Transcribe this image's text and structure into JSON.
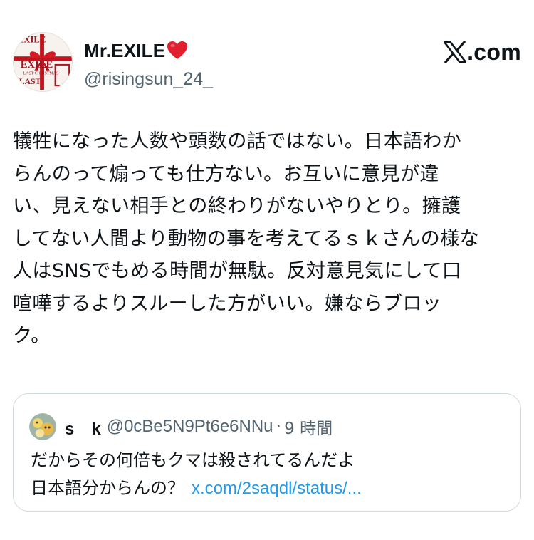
{
  "author": {
    "display_name": "Mr.EXILE",
    "name_emoji_icon": "red-heart-icon",
    "handle": "@risingsun_24_",
    "avatar_text": [
      "EXILE",
      "EXILE",
      "LAST CHRISTMAS",
      "LAST"
    ]
  },
  "brand": {
    "logo_icon": "x-logo-icon",
    "domain": ".com"
  },
  "tweet": {
    "lines": [
      "犠牲になった人数や頭数の話ではない。日本語わか",
      "らんのって煽っても仕方ない。お互いに意見が違",
      "い、見えない相手との終わりがないやりとり。擁護",
      "してない人間より動物の事を考えてるｓｋさんの様な",
      "人はSNSでもめる時間が無駄。反対意見気にして口",
      "喧嘩するよりスルーした方がいい。嫌ならブロッ",
      "ク。"
    ]
  },
  "quoted_tweet": {
    "display_name": "s　k",
    "handle": "@0cBe5N9Pt6e6NNu",
    "separator": "·",
    "time": "9 時間",
    "line1": "だからその何倍もクマは殺されてるんだよ",
    "line2": "日本語分からんの？",
    "link": "x.com/2saqdl/status/..."
  },
  "colors": {
    "text": "#0f1419",
    "secondary": "#536471",
    "link": "#1d9bf0",
    "border": "#cfd9de",
    "heart": "#e0202e"
  }
}
